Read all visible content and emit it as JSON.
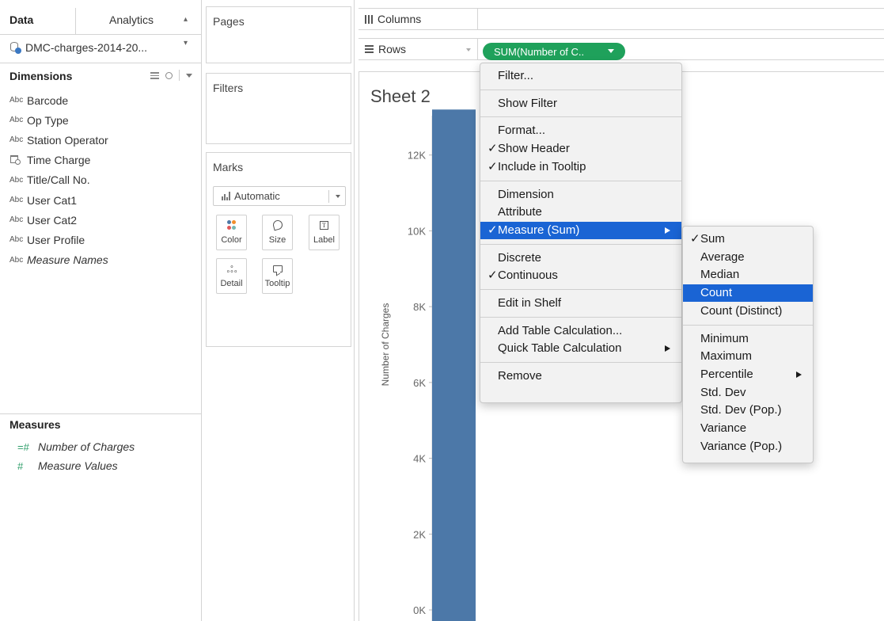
{
  "data_pane": {
    "tabs": [
      "Data",
      "Analytics"
    ],
    "datasource": "DMC-charges-2014-20...",
    "dimensions_title": "Dimensions",
    "dimensions": [
      {
        "type": "Abc",
        "label": "Barcode",
        "italic": false
      },
      {
        "type": "Abc",
        "label": "Op Type",
        "italic": false
      },
      {
        "type": "Abc",
        "label": "Station Operator",
        "italic": false
      },
      {
        "type": "date",
        "label": "Time Charge",
        "italic": false
      },
      {
        "type": "Abc",
        "label": "Title/Call No.",
        "italic": false
      },
      {
        "type": "Abc",
        "label": "User Cat1",
        "italic": false
      },
      {
        "type": "Abc",
        "label": "User Cat2",
        "italic": false
      },
      {
        "type": "Abc",
        "label": "User Profile",
        "italic": false
      },
      {
        "type": "Abc",
        "label": "Measure Names",
        "italic": true
      }
    ],
    "measures_title": "Measures",
    "measures": [
      {
        "type": "=#",
        "label": "Number of Charges"
      },
      {
        "type": "#",
        "label": "Measure Values"
      }
    ]
  },
  "shelves": {
    "pages": "Pages",
    "filters": "Filters",
    "marks": "Marks",
    "mark_type": "Automatic",
    "mark_buttons": [
      "Color",
      "Size",
      "Label",
      "Detail",
      "Tooltip"
    ]
  },
  "view": {
    "columns_label": "Columns",
    "rows_label": "Rows",
    "rows_pill": "SUM(Number of C..",
    "sheet_title": "Sheet 2"
  },
  "colors": {
    "bar": "#4c78a8",
    "pill": "#1fa15b",
    "menu_selection": "#1a64d4",
    "measure_icon": "#2e9e6a",
    "color_dots": [
      "#4e79a7",
      "#f28e2b",
      "#e15759",
      "#76b7b2"
    ]
  },
  "chart_data": {
    "type": "bar",
    "ylabel": "Number of Charges",
    "yticks": [
      "0K",
      "2K",
      "4K",
      "6K",
      "8K",
      "10K",
      "12K"
    ],
    "ylim": [
      0,
      14000
    ],
    "series": [
      {
        "values": [
          13200
        ]
      }
    ]
  },
  "context_menu": {
    "items": [
      {
        "label": "Filter...",
        "check": false,
        "arrow": false,
        "selected": false,
        "sep_before": false
      },
      {
        "label": "Show Filter",
        "check": false,
        "arrow": false,
        "selected": false,
        "sep_before": true
      },
      {
        "label": "Format...",
        "check": false,
        "arrow": false,
        "selected": false,
        "sep_before": true
      },
      {
        "label": "Show Header",
        "check": true,
        "arrow": false,
        "selected": false,
        "sep_before": false
      },
      {
        "label": "Include in Tooltip",
        "check": true,
        "arrow": false,
        "selected": false,
        "sep_before": false
      },
      {
        "label": "Dimension",
        "check": false,
        "arrow": false,
        "selected": false,
        "sep_before": true
      },
      {
        "label": "Attribute",
        "check": false,
        "arrow": false,
        "selected": false,
        "sep_before": false
      },
      {
        "label": "Measure (Sum)",
        "check": true,
        "arrow": true,
        "selected": true,
        "sep_before": false
      },
      {
        "label": "Discrete",
        "check": false,
        "arrow": false,
        "selected": false,
        "sep_before": true
      },
      {
        "label": "Continuous",
        "check": true,
        "arrow": false,
        "selected": false,
        "sep_before": false
      },
      {
        "label": "Edit in Shelf",
        "check": false,
        "arrow": false,
        "selected": false,
        "sep_before": true
      },
      {
        "label": "Add Table Calculation...",
        "check": false,
        "arrow": false,
        "selected": false,
        "sep_before": true
      },
      {
        "label": "Quick Table Calculation",
        "check": false,
        "arrow": true,
        "selected": false,
        "sep_before": false
      },
      {
        "label": "Remove",
        "check": false,
        "arrow": false,
        "selected": false,
        "sep_before": true
      }
    ]
  },
  "submenu": {
    "items": [
      {
        "label": "Sum",
        "check": true,
        "arrow": false,
        "selected": false,
        "sep_before": false
      },
      {
        "label": "Average",
        "check": false,
        "arrow": false,
        "selected": false,
        "sep_before": false
      },
      {
        "label": "Median",
        "check": false,
        "arrow": false,
        "selected": false,
        "sep_before": false
      },
      {
        "label": "Count",
        "check": false,
        "arrow": false,
        "selected": true,
        "sep_before": false
      },
      {
        "label": "Count (Distinct)",
        "check": false,
        "arrow": false,
        "selected": false,
        "sep_before": false
      },
      {
        "label": "Minimum",
        "check": false,
        "arrow": false,
        "selected": false,
        "sep_before": true
      },
      {
        "label": "Maximum",
        "check": false,
        "arrow": false,
        "selected": false,
        "sep_before": false
      },
      {
        "label": "Percentile",
        "check": false,
        "arrow": true,
        "selected": false,
        "sep_before": false
      },
      {
        "label": "Std. Dev",
        "check": false,
        "arrow": false,
        "selected": false,
        "sep_before": false
      },
      {
        "label": "Std. Dev (Pop.)",
        "check": false,
        "arrow": false,
        "selected": false,
        "sep_before": false
      },
      {
        "label": "Variance",
        "check": false,
        "arrow": false,
        "selected": false,
        "sep_before": false
      },
      {
        "label": "Variance (Pop.)",
        "check": false,
        "arrow": false,
        "selected": false,
        "sep_before": false
      }
    ]
  }
}
